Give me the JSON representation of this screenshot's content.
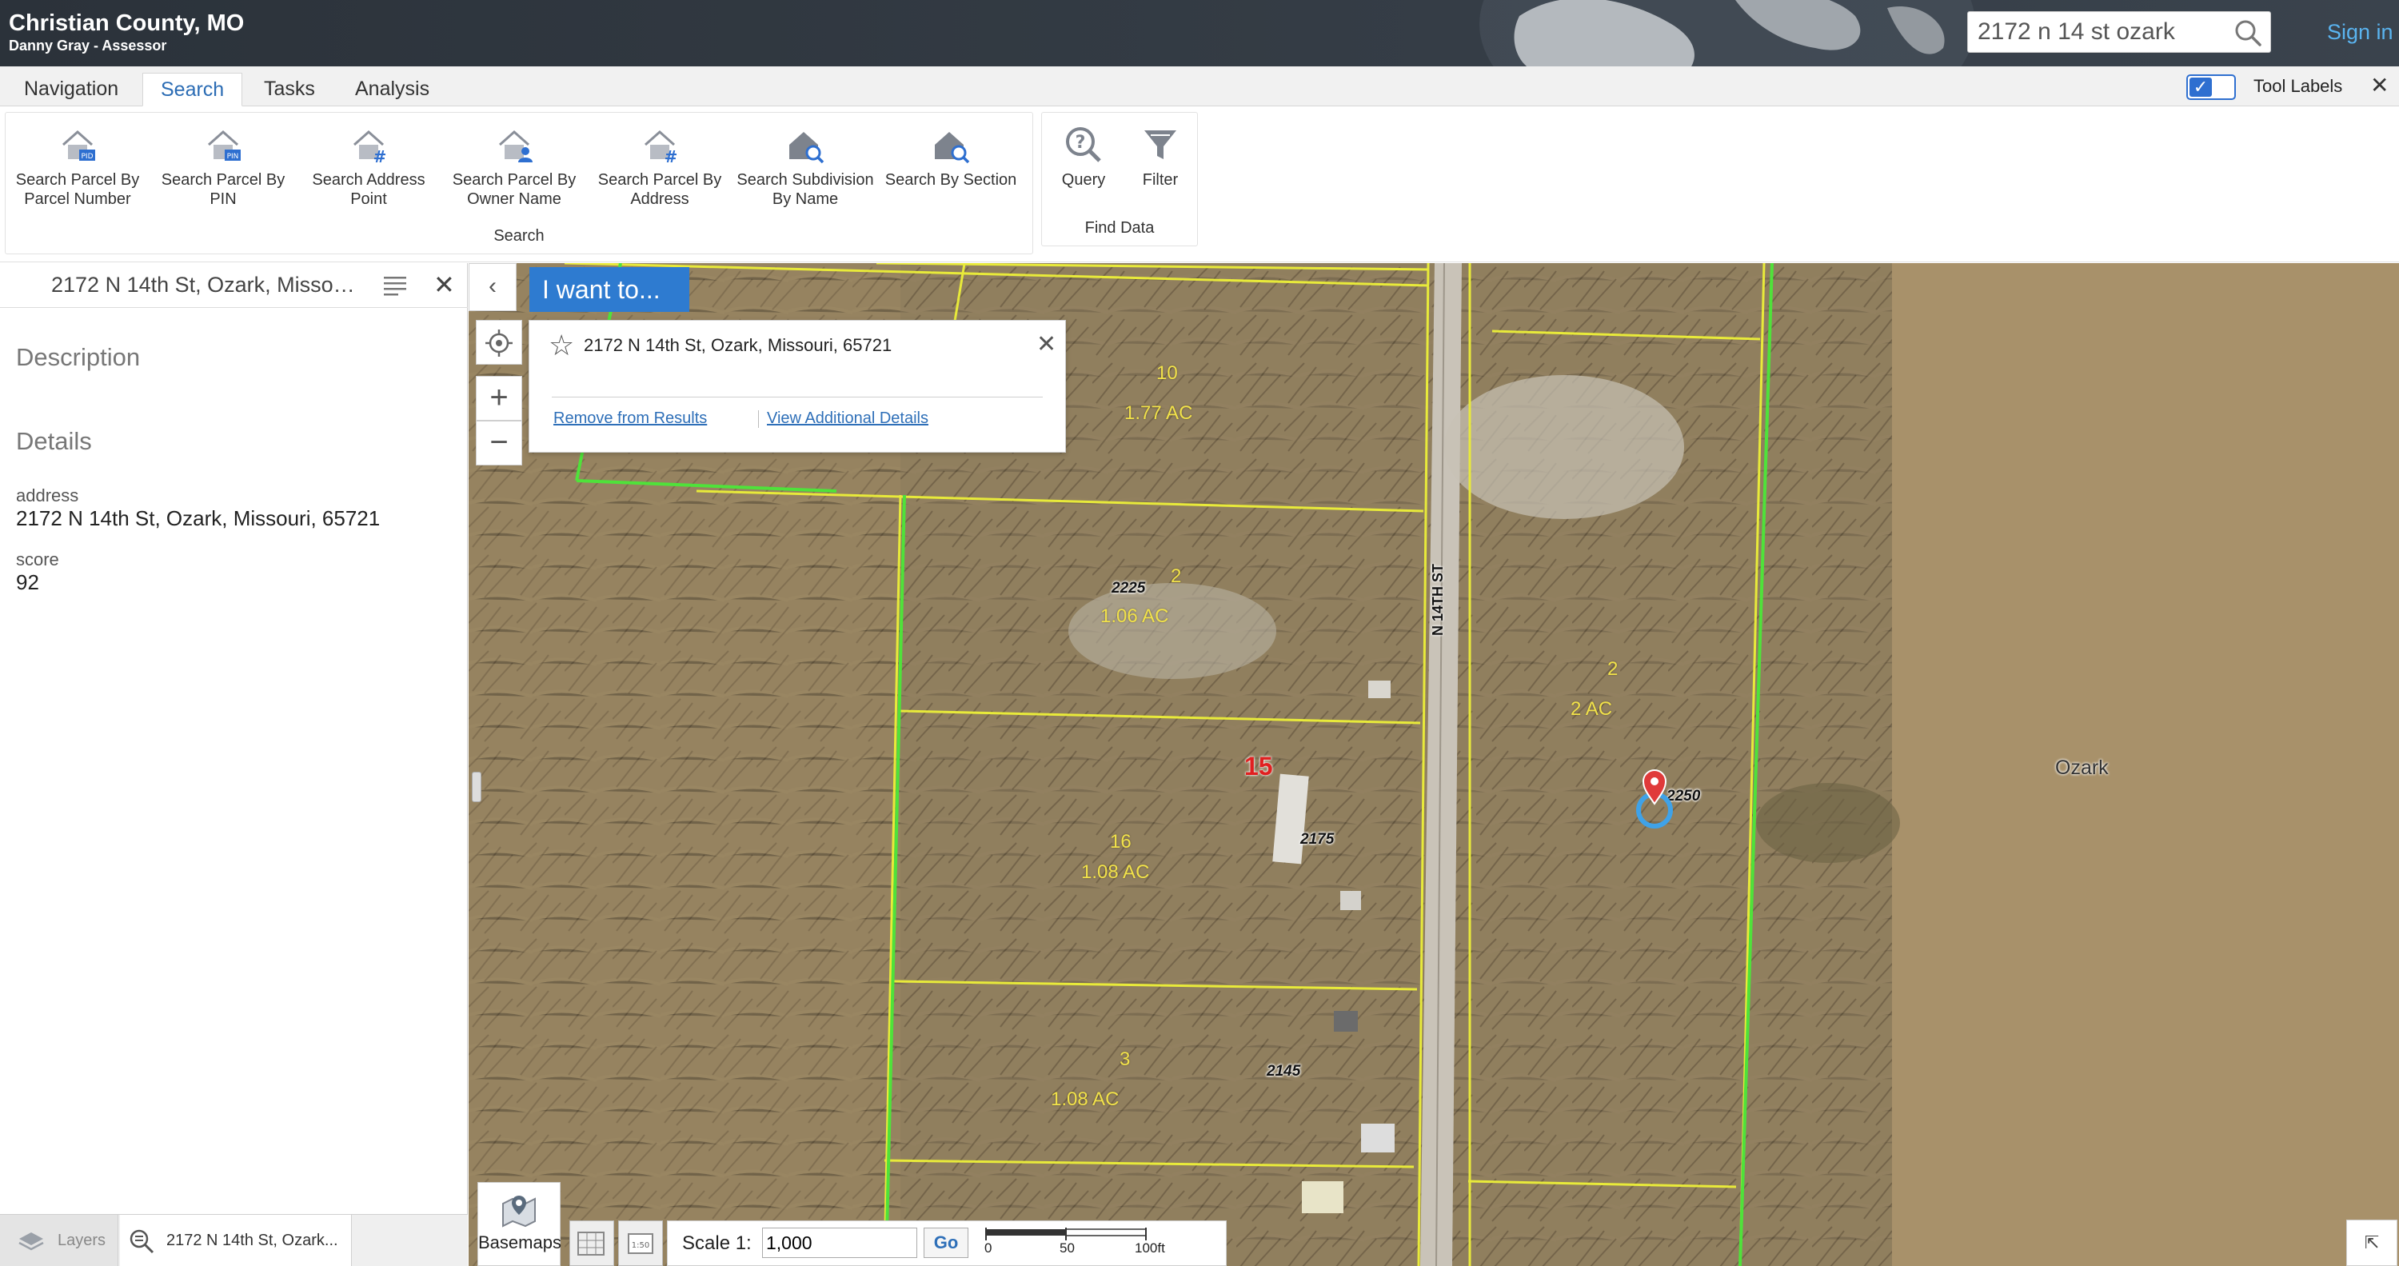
{
  "header": {
    "title": "Christian County, MO",
    "subtitle": "Danny Gray - Assessor",
    "search_value": "2172 n 14 st ozark",
    "sign_in": "Sign in"
  },
  "tabs": [
    "Navigation",
    "Search",
    "Tasks",
    "Analysis"
  ],
  "active_tab": "Search",
  "tool_labels": {
    "label": "Tool Labels",
    "checked": true
  },
  "ribbon": {
    "search_group": {
      "label": "Search",
      "tools": [
        {
          "label": "Search Parcel By Parcel Number",
          "icon": "house-pid-icon"
        },
        {
          "label": "Search Parcel By PIN",
          "icon": "house-pin-icon"
        },
        {
          "label": "Search Address Point",
          "icon": "house-hash-icon"
        },
        {
          "label": "Search Parcel By Owner Name",
          "icon": "house-person-icon"
        },
        {
          "label": "Search Parcel By Address",
          "icon": "house-hash-icon"
        },
        {
          "label": "Search Subdivision By Name",
          "icon": "house-magnifier-icon"
        },
        {
          "label": "Search By Section",
          "icon": "house-magnifier-icon"
        }
      ]
    },
    "find_group": {
      "label": "Find Data",
      "tools": [
        {
          "label": "Query",
          "icon": "query-icon"
        },
        {
          "label": "Filter",
          "icon": "filter-icon"
        }
      ]
    }
  },
  "left_panel": {
    "title": "2172 N 14th St, Ozark, Misso…",
    "description_heading": "Description",
    "details_heading": "Details",
    "fields": [
      {
        "key": "address",
        "value": "2172 N 14th St, Ozark, Missouri, 65721"
      },
      {
        "key": "score",
        "value": "92"
      }
    ]
  },
  "bottom_tabs": {
    "layers": "Layers",
    "results": "2172 N 14th St, Ozark..."
  },
  "map": {
    "i_want_to": "I want to...",
    "popup": {
      "title": "2172 N 14th St, Ozark, Missouri, 65721",
      "remove_link": "Remove from Results",
      "details_link": "View Additional Details"
    },
    "parcels": [
      {
        "lot": "10",
        "area": "1.77 AC"
      },
      {
        "lot": "2",
        "area": "1.06 AC"
      },
      {
        "lot": "16",
        "area": "1.08 AC"
      },
      {
        "lot": "3",
        "area": "1.08 AC"
      },
      {
        "lot": "2",
        "area": "2 AC"
      }
    ],
    "addresses": [
      "2225",
      "2175",
      "2145",
      "2250"
    ],
    "highlight_lot": "15",
    "street": "N 14TH ST",
    "city": "Ozark",
    "basemaps": "Basemaps",
    "scale_label": "Scale 1:",
    "scale_value": "1,000",
    "go": "Go",
    "scale_ticks": [
      "0",
      "50",
      "100ft"
    ]
  },
  "colors": {
    "header_bg": "#2b323a",
    "accent": "#2e7bd0",
    "parcel_line": "#e8ea3a",
    "boundary_line": "#4fe23a",
    "marker": "#e03a3a"
  }
}
